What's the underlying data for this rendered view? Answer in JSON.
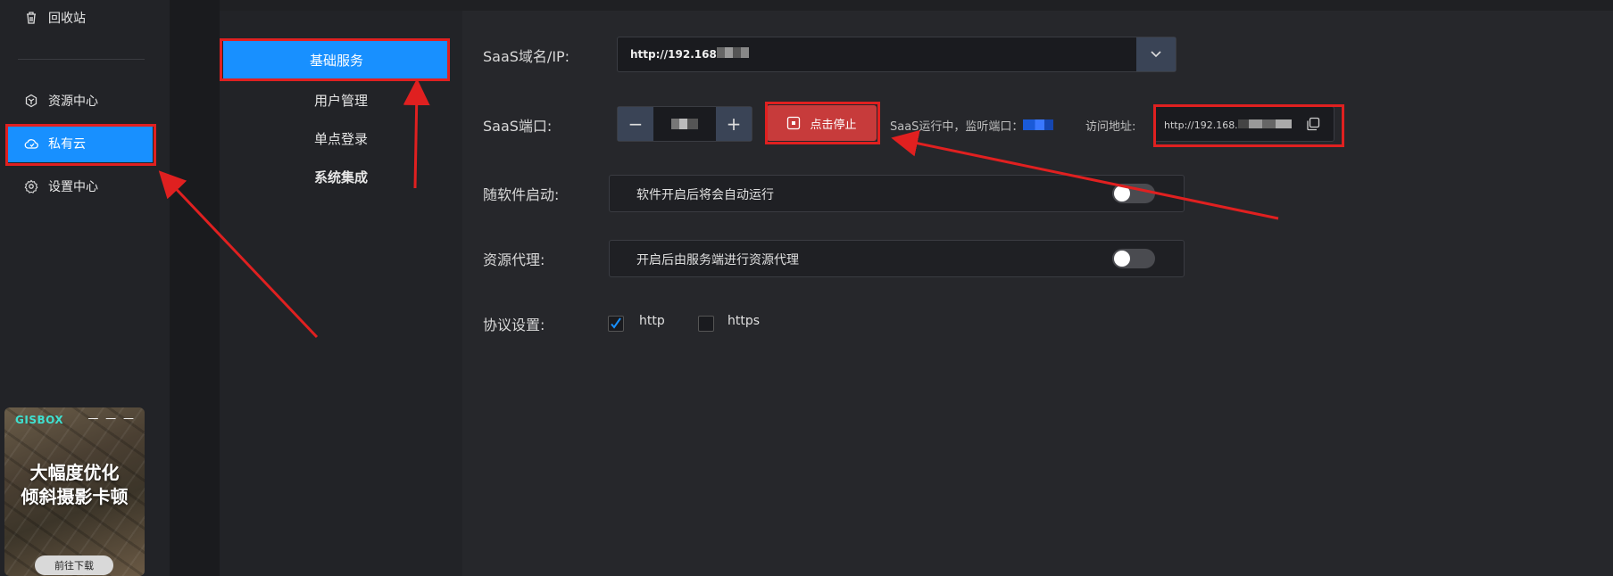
{
  "sidebar": {
    "items": [
      {
        "label": "回收站",
        "icon": "trash-icon"
      },
      {
        "label": "资源中心",
        "icon": "hexagon-icon"
      },
      {
        "label": "私有云",
        "icon": "cloud-icon"
      },
      {
        "label": "设置中心",
        "icon": "gear-icon"
      }
    ],
    "active": "私有云"
  },
  "ad": {
    "logo": "GISBOX",
    "headline_line1": "大幅度优化",
    "headline_line2": "倾斜摄影卡顿",
    "cta": "前往下载"
  },
  "subnav": {
    "items": [
      {
        "label": "基础服务"
      },
      {
        "label": "用户管理"
      },
      {
        "label": "单点登录"
      },
      {
        "label": "系统集成"
      }
    ],
    "active": "基础服务"
  },
  "form": {
    "domain": {
      "label": "SaaS域名/IP:",
      "value": "http://192.168"
    },
    "port": {
      "label": "SaaS端口:",
      "minus": "−",
      "plus": "+"
    },
    "stop_button": "点击停止",
    "status_text": "SaaS运行中，监听端口：",
    "access_label": "访问地址:",
    "access_value": "http://192.168.",
    "autostart": {
      "label": "随软件启动:",
      "desc": "软件开启后将会自动运行",
      "enabled": false
    },
    "proxy": {
      "label": "资源代理:",
      "desc": "开启后由服务端进行资源代理",
      "enabled": false
    },
    "protocol": {
      "label": "协议设置:",
      "options": [
        {
          "label": "http",
          "checked": true
        },
        {
          "label": "https",
          "checked": false
        }
      ]
    }
  },
  "colors": {
    "accent": "#1890ff",
    "danger": "#c73b3b",
    "annotation": "#e02020"
  }
}
